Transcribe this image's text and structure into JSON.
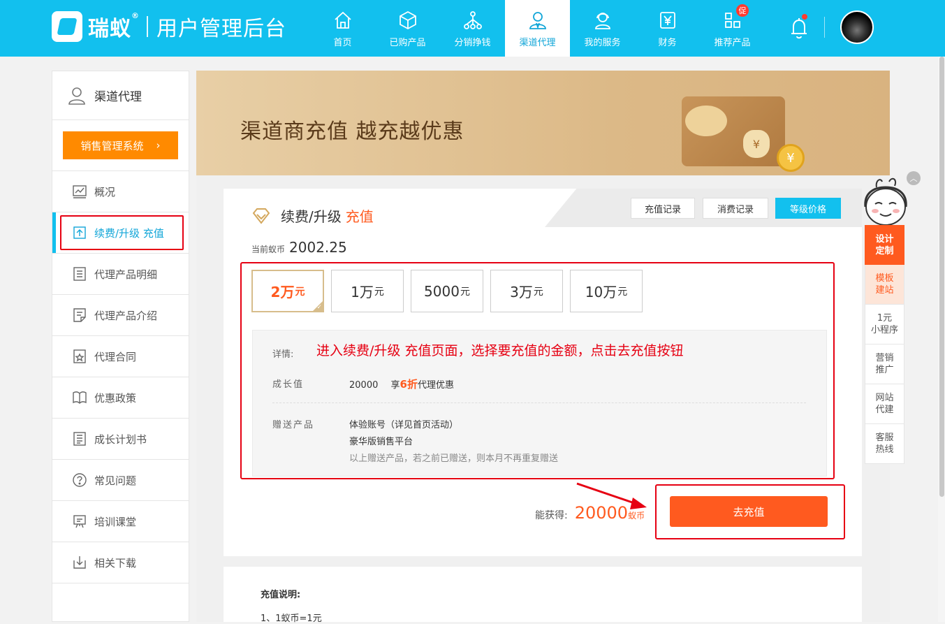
{
  "header": {
    "brand": "瑞蚁",
    "brand_reg": "®",
    "subtitle": "用户管理后台",
    "nav": [
      {
        "label": "首页",
        "icon": "home-icon"
      },
      {
        "label": "已购产品",
        "icon": "box-icon"
      },
      {
        "label": "分销挣钱",
        "icon": "share-network-icon"
      },
      {
        "label": "渠道代理",
        "icon": "agent-user-icon"
      },
      {
        "label": "我的服务",
        "icon": "customer-service-icon"
      },
      {
        "label": "财务",
        "icon": "finance-yen-icon"
      },
      {
        "label": "推荐产品",
        "icon": "recommend-grid-icon",
        "badge": "促"
      }
    ],
    "active_nav": "渠道代理"
  },
  "sidebar": {
    "title": "渠道代理",
    "sales_button": "销售管理系统",
    "items": [
      {
        "label": "概况",
        "icon": "chart-icon"
      },
      {
        "label": "续费/升级 充值",
        "icon": "upgrade-icon"
      },
      {
        "label": "代理产品明细",
        "icon": "list-icon"
      },
      {
        "label": "代理产品介绍",
        "icon": "document-icon"
      },
      {
        "label": "代理合同",
        "icon": "contract-icon"
      },
      {
        "label": "优惠政策",
        "icon": "policy-book-icon"
      },
      {
        "label": "成长计划书",
        "icon": "plan-icon"
      },
      {
        "label": "常见问题",
        "icon": "question-icon"
      },
      {
        "label": "培训课堂",
        "icon": "classroom-icon"
      },
      {
        "label": "相关下载",
        "icon": "download-icon"
      }
    ],
    "active_item": "续费/升级 充值"
  },
  "banner": {
    "title": "渠道商充值   越充越优惠",
    "coin_symbol": "¥"
  },
  "card": {
    "title": "续费/升级",
    "title_accent": "充值",
    "tabs": [
      "充值记录",
      "消费记录",
      "等级价格"
    ],
    "balance_label": "当前蚁币",
    "balance_value": "2002.25",
    "amounts": [
      {
        "num": "2万",
        "unit": "元"
      },
      {
        "num": "1万",
        "unit": "元"
      },
      {
        "num": "5000",
        "unit": "元"
      },
      {
        "num": "3万",
        "unit": "元"
      },
      {
        "num": "10万",
        "unit": "元"
      }
    ],
    "selected_amount": "2万",
    "detail": {
      "label_detail": "详情:",
      "annotation": "进入续费/升级 充值页面，选择要充值的金额，点击去充值按钮",
      "label_growth": "成长值",
      "growth_value": "20000",
      "growth_prefix": "享",
      "growth_discount": "6折",
      "growth_suffix": "代理优惠",
      "label_gift": "赠送产品",
      "gift_1": "体验账号（详见首页活动）",
      "gift_2": "豪华版销售平台",
      "gift_note": "以上赠送产品，若之前已赠送，则本月不再重复赠送"
    },
    "gain_label": "能获得:",
    "gain_value": "20000",
    "gain_unit": "蚁币",
    "recharge_button": "去充值"
  },
  "notes": {
    "title": "充值说明:",
    "line1": "1、1蚁币=1元"
  },
  "float_menu": [
    {
      "line1": "设计",
      "line2": "定制"
    },
    {
      "line1": "模板",
      "line2": "建站"
    },
    {
      "line1": "1元",
      "line2": "小程序"
    },
    {
      "line1": "营销",
      "line2": "推广"
    },
    {
      "line1": "网站",
      "line2": "代建"
    },
    {
      "line1": "客服",
      "line2": "热线"
    }
  ],
  "colors": {
    "topbar": "#12c0ee",
    "accent_orange": "#ff5a1f",
    "sales_orange": "#ff8a00",
    "annotation_red": "#e60012"
  }
}
